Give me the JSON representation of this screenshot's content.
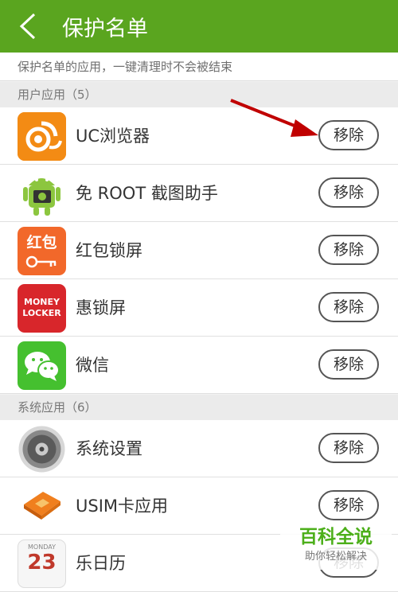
{
  "header": {
    "title": "保护名单"
  },
  "subtitle": "保护名单的应用，一键清理时不会被结束",
  "sections": [
    {
      "label": "用户应用（5）"
    },
    {
      "label": "系统应用（6）"
    }
  ],
  "user_apps": [
    {
      "name": "UC浏览器",
      "icon": "uc-browser-icon"
    },
    {
      "name": "免 ROOT 截图助手",
      "icon": "android-screenshot-icon"
    },
    {
      "name": "红包锁屏",
      "icon": "hongbao-lock-icon",
      "icon_text": "红包"
    },
    {
      "name": "惠锁屏",
      "icon": "money-locker-icon",
      "icon_text": "MONEY LOCKER"
    },
    {
      "name": "微信",
      "icon": "wechat-icon"
    }
  ],
  "system_apps": [
    {
      "name": "系统设置",
      "icon": "settings-gear-icon"
    },
    {
      "name": "USIM卡应用",
      "icon": "sim-card-icon"
    },
    {
      "name": "乐日历",
      "icon": "calendar-icon",
      "icon_text": "MONDAY",
      "icon_day": "23"
    }
  ],
  "remove_label": "移除",
  "watermark": {
    "title": "百科全说",
    "subtitle": "助你轻松解决"
  },
  "colors": {
    "header": "#5aa51f",
    "arrow": "#c00000"
  }
}
